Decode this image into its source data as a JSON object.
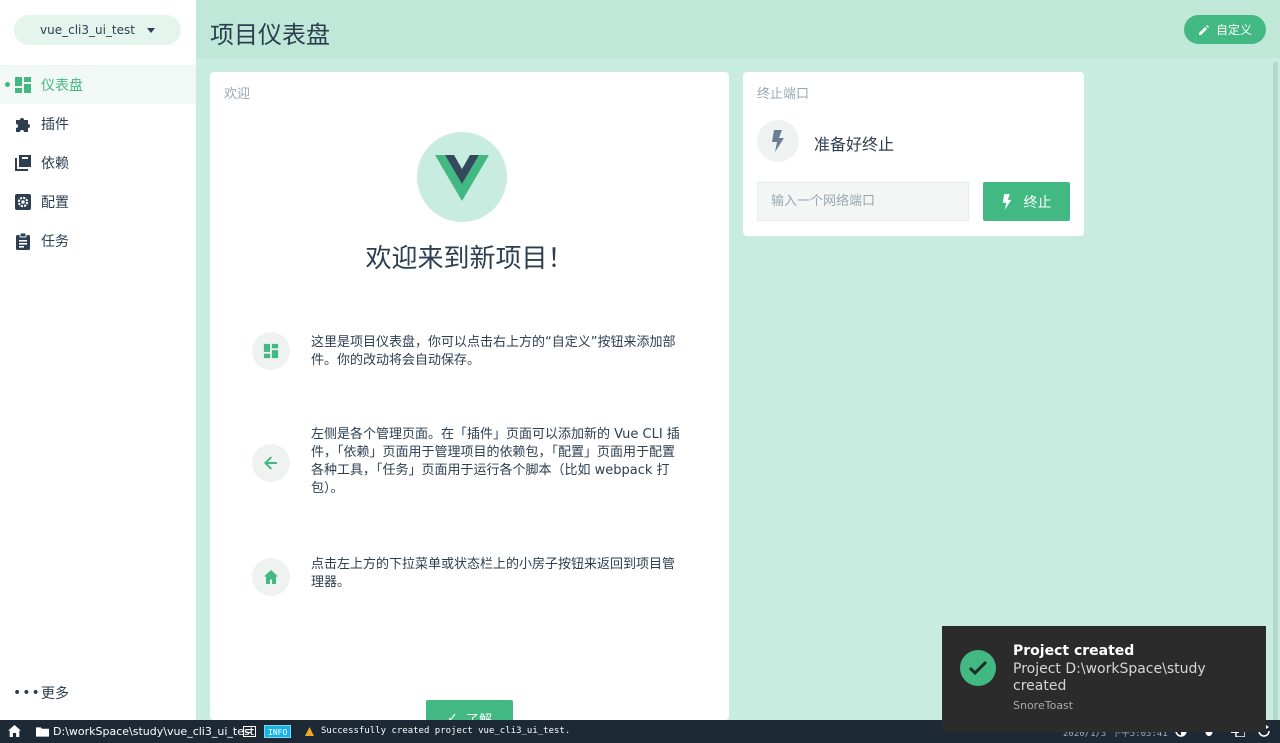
{
  "sidebar": {
    "project_name": "vue_cli3_ui_test",
    "items": [
      {
        "label": "仪表盘",
        "icon": "dashboard-icon",
        "active": true
      },
      {
        "label": "插件",
        "icon": "puzzle-icon"
      },
      {
        "label": "依赖",
        "icon": "library-icon"
      },
      {
        "label": "配置",
        "icon": "settings-icon"
      },
      {
        "label": "任务",
        "icon": "clipboard-icon"
      }
    ],
    "more_label": "更多"
  },
  "header": {
    "title": "项目仪表盘",
    "customize_label": "自定义"
  },
  "welcome": {
    "card_title": "欢迎",
    "heading": "欢迎来到新项目！",
    "tips": [
      {
        "icon": "dashboard-icon",
        "text": "这里是项目仪表盘，你可以点击右上方的“自定义”按钮来添加部件。你的改动将会自动保存。"
      },
      {
        "icon": "arrow-left-icon",
        "text": "左侧是各个管理页面。在「插件」页面可以添加新的 Vue CLI 插件，「依赖」页面用于管理项目的依赖包，「配置」页面用于配置各种工具，「任务」页面用于运行各个脚本（比如 webpack 打包）。"
      },
      {
        "icon": "home-icon",
        "text": "点击左上方的下拉菜单或状态栏上的小房子按钮来返回到项目管理器。"
      }
    ],
    "got_it_label": "了解"
  },
  "kill_port": {
    "card_title": "终止端口",
    "status": "准备好终止",
    "input_placeholder": "输入一个网络端口",
    "button_label": "终止"
  },
  "statusbar": {
    "path": "D:\\workSpace\\study\\vue_cli3_ui_test",
    "log_level": "INFO",
    "message": "Successfully created project vue_cli3_ui_test.",
    "time": "2020/1/3 下午5:03:41"
  },
  "toast": {
    "title": "Project created",
    "body": "Project D:\\workSpace\\study created",
    "source": "SnoreToast"
  },
  "colors": {
    "accent": "#42b983",
    "background": "#c8ede0",
    "statusbar": "#1d2935",
    "toast": "#2b2b2b"
  }
}
